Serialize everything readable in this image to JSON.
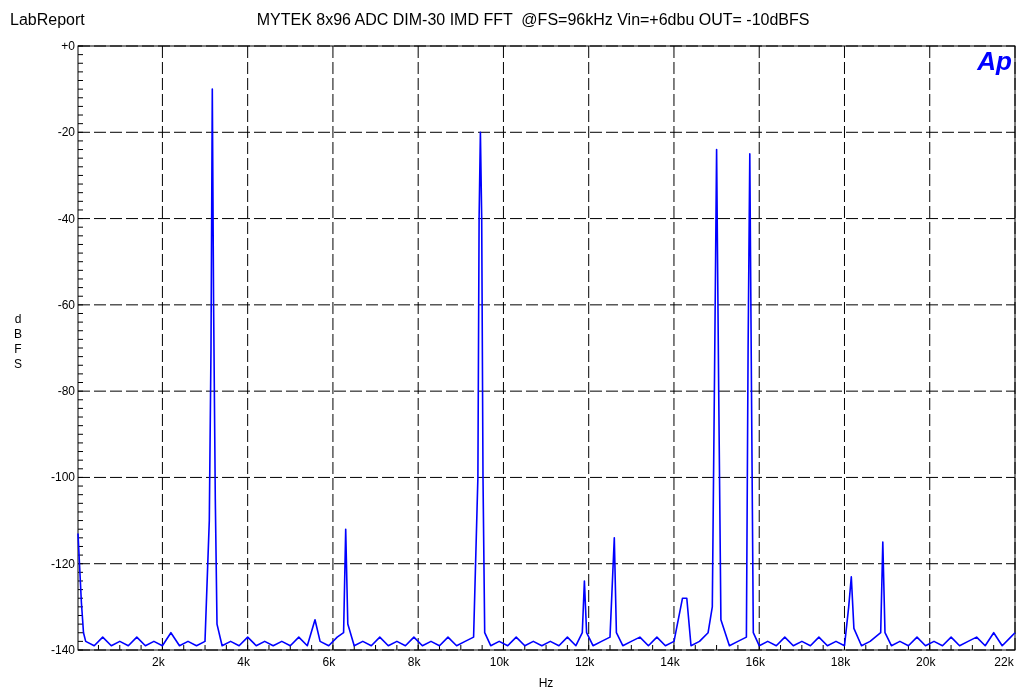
{
  "header": {
    "app_name": "LabReport",
    "title": "MYTEK 8x96 ADC DIM-30 IMD FFT  @FS=96kHz Vin=+6dbu OUT= -10dBFS",
    "logo": "Ap"
  },
  "chart_data": {
    "type": "line",
    "grid": true,
    "xlabel": "Hz",
    "ylabel": "dBFS",
    "xlim": [
      20,
      22000
    ],
    "ylim": [
      -140,
      0
    ],
    "xticks": [
      {
        "value": 2000,
        "label": "2k"
      },
      {
        "value": 4000,
        "label": "4k"
      },
      {
        "value": 6000,
        "label": "6k"
      },
      {
        "value": 8000,
        "label": "8k"
      },
      {
        "value": 10000,
        "label": "10k"
      },
      {
        "value": 12000,
        "label": "12k"
      },
      {
        "value": 14000,
        "label": "14k"
      },
      {
        "value": 16000,
        "label": "16k"
      },
      {
        "value": 18000,
        "label": "18k"
      },
      {
        "value": 20000,
        "label": "20k"
      },
      {
        "value": 22000,
        "label": "22k"
      }
    ],
    "yticks": [
      {
        "value": 0,
        "label": "+0"
      },
      -20,
      -40,
      -60,
      -80,
      -100,
      -120,
      -140
    ],
    "x": [
      20,
      60,
      100,
      150,
      200,
      400,
      600,
      800,
      1000,
      1200,
      1400,
      1600,
      1800,
      2000,
      2200,
      2400,
      2600,
      2800,
      3000,
      3100,
      3140,
      3170,
      3200,
      3240,
      3280,
      3400,
      3600,
      3800,
      4000,
      4200,
      4400,
      4600,
      4800,
      5000,
      5200,
      5400,
      5580,
      5700,
      5900,
      6100,
      6250,
      6300,
      6350,
      6500,
      6700,
      6900,
      7100,
      7300,
      7500,
      7700,
      7900,
      8100,
      8300,
      8500,
      8700,
      8900,
      9100,
      9300,
      9400,
      9430,
      9460,
      9490,
      9520,
      9560,
      9700,
      9900,
      10100,
      10300,
      10500,
      10700,
      10900,
      11100,
      11300,
      11500,
      11700,
      11850,
      11900,
      11950,
      12100,
      12300,
      12500,
      12600,
      12650,
      12800,
      13000,
      13200,
      13400,
      13600,
      13800,
      14000,
      14200,
      14300,
      14400,
      14600,
      14800,
      14900,
      14950,
      15000,
      15050,
      15100,
      15300,
      15500,
      15700,
      15740,
      15780,
      15820,
      15860,
      16000,
      16200,
      16400,
      16600,
      16800,
      17000,
      17200,
      17400,
      17600,
      17800,
      18000,
      18100,
      18160,
      18220,
      18400,
      18600,
      18850,
      18900,
      18950,
      19100,
      19300,
      19500,
      19700,
      19900,
      20100,
      20300,
      20500,
      20700,
      20900,
      21100,
      21300,
      21500,
      21700,
      21900,
      22000
    ],
    "series": [
      {
        "color": "#0000ff",
        "values": [
          -113,
          -121,
          -129,
          -136,
          -138,
          -139,
          -137,
          -139,
          -138,
          -139,
          -137,
          -139,
          -138,
          -139,
          -136,
          -139,
          -138,
          -139,
          -138,
          -110,
          -70,
          -10,
          -60,
          -105,
          -134,
          -139,
          -138,
          -139,
          -137,
          -139,
          -138,
          -139,
          -138,
          -139,
          -137,
          -139,
          -133,
          -138,
          -139,
          -137,
          -136,
          -112,
          -134,
          -139,
          -138,
          -139,
          -137,
          -139,
          -138,
          -139,
          -137,
          -139,
          -138,
          -139,
          -137,
          -139,
          -138,
          -137,
          -100,
          -40,
          -20,
          -40,
          -100,
          -136,
          -139,
          -138,
          -139,
          -137,
          -139,
          -138,
          -139,
          -138,
          -139,
          -137,
          -139,
          -136,
          -124,
          -136,
          -139,
          -138,
          -137,
          -114,
          -136,
          -139,
          -138,
          -137,
          -139,
          -137,
          -139,
          -138,
          -128,
          -128,
          -139,
          -138,
          -136,
          -130,
          -77,
          -24,
          -80,
          -133,
          -139,
          -138,
          -137,
          -70,
          -25,
          -80,
          -136,
          -139,
          -138,
          -139,
          -137,
          -139,
          -138,
          -139,
          -137,
          -139,
          -138,
          -139,
          -130,
          -123,
          -135,
          -139,
          -138,
          -136,
          -115,
          -136,
          -139,
          -138,
          -139,
          -137,
          -139,
          -138,
          -139,
          -137,
          -139,
          -138,
          -137,
          -139,
          -136,
          -139,
          -137,
          -136
        ]
      }
    ]
  }
}
